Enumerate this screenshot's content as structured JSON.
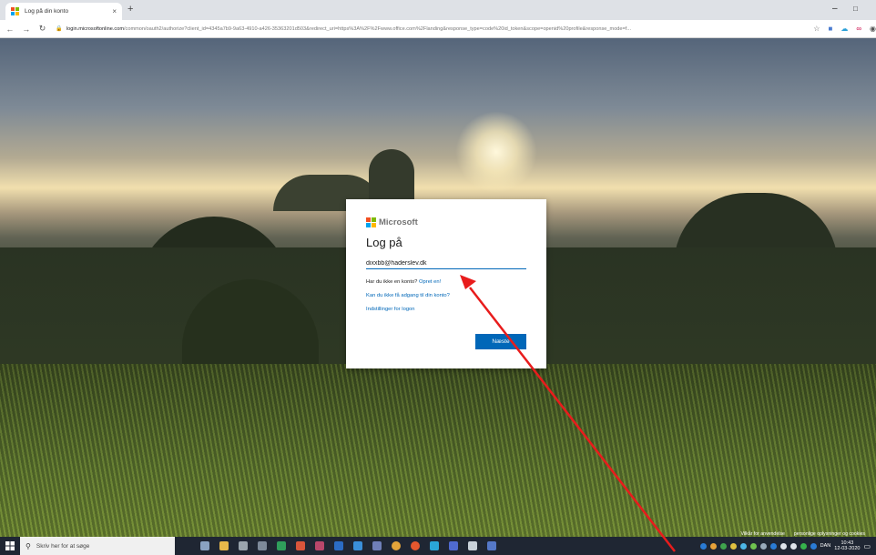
{
  "browser": {
    "tab_title": "Log på din konto",
    "tab_close": "×",
    "new_tab": "+",
    "minimize": "–",
    "maximize": "□",
    "url_host": "login.microsoftonline.com",
    "url_path": "/common/oauth2/authorize?client_id=4345a7b9-9a63-4910-a426-35363201d503&redirect_uri=https%3A%2F%2Fwww.office.com%2Flanding&response_type=code%20id_token&scope=openid%20profile&response_mode=f..."
  },
  "signin": {
    "brand": "Microsoft",
    "title": "Log på",
    "email_value": "dixxbb@haderslev.dk",
    "no_account_text": "Har du ikke en konto?",
    "create_link": "Opret en!",
    "cant_access_link": "Kan du ikke få adgang til din konto?",
    "signin_options_link": "Indstillinger for logon",
    "next_button": "Næste"
  },
  "footer": {
    "terms": "Vilkår for anvendelse",
    "privacy": "personlige oplysninger og cookies"
  },
  "taskbar": {
    "search_placeholder": "Skriv her for at søge",
    "language": "DAN",
    "time": "10:43",
    "date": "12-03-2020"
  },
  "colors": {
    "accent": "#0067b8",
    "ms_red": "#f25022",
    "ms_green": "#7fba00",
    "ms_blue": "#00a4ef",
    "ms_yellow": "#ffb900",
    "arrow": "#e81c1c"
  },
  "icons": [
    "microsoft-logo-icon",
    "lock-icon",
    "back-icon",
    "forward-icon",
    "reload-icon",
    "windows-start-icon",
    "search-icon"
  ]
}
